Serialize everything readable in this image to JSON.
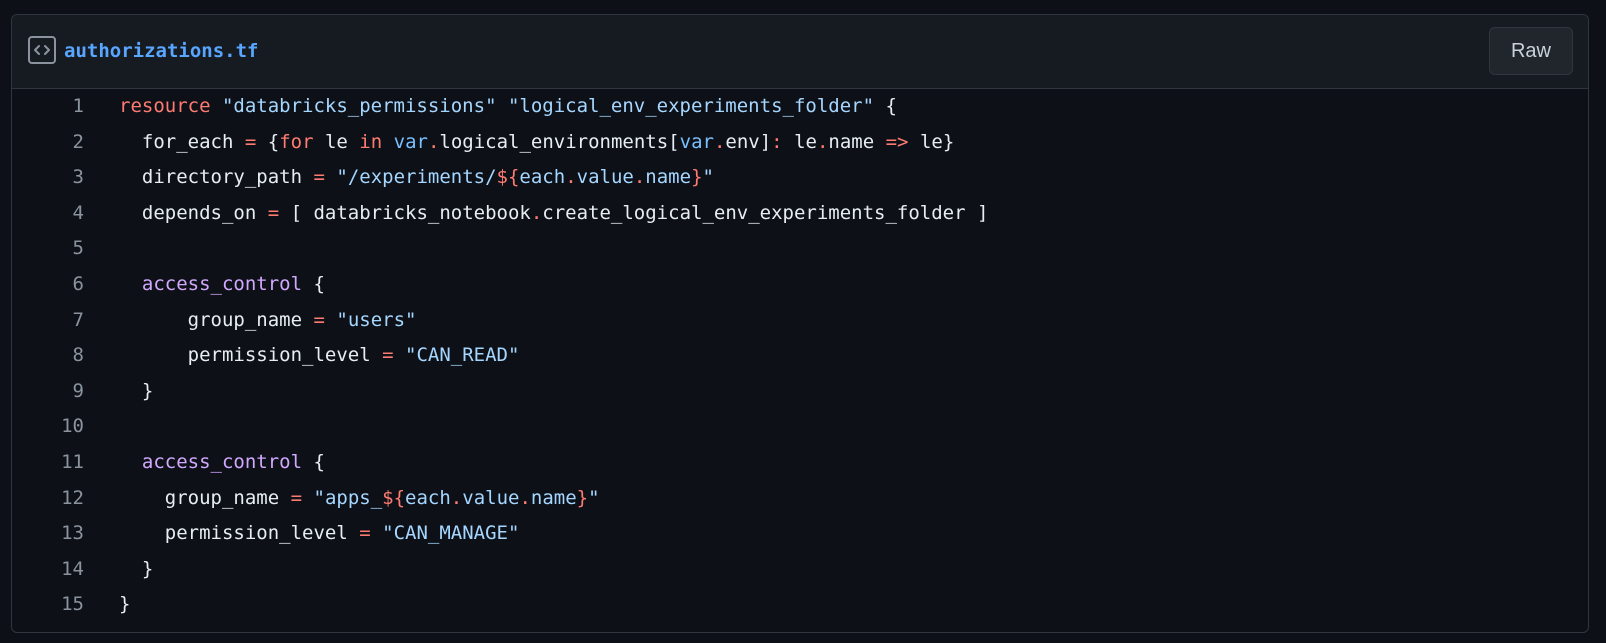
{
  "file": {
    "name": "authorizations.tf",
    "raw_label": "Raw"
  },
  "colors": {
    "background": "#0d1117",
    "header": "#161b22",
    "border": "#30363d",
    "filename": "#58a6ff",
    "keyword": "#ff7b72",
    "string": "#a5d6ff",
    "block": "#d2a8ff",
    "variable": "#79c0ff",
    "text": "#e6edf3",
    "line_number": "#8b949e"
  },
  "icons": {
    "header": "code-file-icon"
  },
  "code": {
    "lines": [
      {
        "number": "1",
        "tokens": [
          {
            "t": "resource",
            "c": "kw"
          },
          {
            "t": " ",
            "c": "plain"
          },
          {
            "t": "\"databricks_permissions\"",
            "c": "str"
          },
          {
            "t": " ",
            "c": "plain"
          },
          {
            "t": "\"logical_env_experiments_folder\"",
            "c": "str"
          },
          {
            "t": " {",
            "c": "plain"
          }
        ]
      },
      {
        "number": "2",
        "tokens": [
          {
            "t": "  for_each ",
            "c": "plain"
          },
          {
            "t": "=",
            "c": "kw"
          },
          {
            "t": " {",
            "c": "plain"
          },
          {
            "t": "for",
            "c": "kw"
          },
          {
            "t": " le ",
            "c": "plain"
          },
          {
            "t": "in",
            "c": "kw"
          },
          {
            "t": " ",
            "c": "plain"
          },
          {
            "t": "var",
            "c": "var"
          },
          {
            "t": ".",
            "c": "kw"
          },
          {
            "t": "logical_environments[",
            "c": "plain"
          },
          {
            "t": "var",
            "c": "var"
          },
          {
            "t": ".",
            "c": "kw"
          },
          {
            "t": "env]",
            "c": "plain"
          },
          {
            "t": ":",
            "c": "kw"
          },
          {
            "t": " le",
            "c": "plain"
          },
          {
            "t": ".",
            "c": "kw"
          },
          {
            "t": "name ",
            "c": "plain"
          },
          {
            "t": "=>",
            "c": "kw"
          },
          {
            "t": " le}",
            "c": "plain"
          }
        ]
      },
      {
        "number": "3",
        "tokens": [
          {
            "t": "  directory_path ",
            "c": "plain"
          },
          {
            "t": "=",
            "c": "kw"
          },
          {
            "t": " ",
            "c": "plain"
          },
          {
            "t": "\"/experiments/",
            "c": "str"
          },
          {
            "t": "${",
            "c": "kw"
          },
          {
            "t": "each",
            "c": "str"
          },
          {
            "t": ".",
            "c": "kw"
          },
          {
            "t": "value",
            "c": "str"
          },
          {
            "t": ".",
            "c": "kw"
          },
          {
            "t": "name",
            "c": "str"
          },
          {
            "t": "}",
            "c": "kw"
          },
          {
            "t": "\"",
            "c": "str"
          }
        ]
      },
      {
        "number": "4",
        "tokens": [
          {
            "t": "  depends_on ",
            "c": "plain"
          },
          {
            "t": "=",
            "c": "kw"
          },
          {
            "t": " [ databricks_notebook",
            "c": "plain"
          },
          {
            "t": ".",
            "c": "kw"
          },
          {
            "t": "create_logical_env_experiments_folder ]",
            "c": "plain"
          }
        ]
      },
      {
        "number": "5",
        "tokens": []
      },
      {
        "number": "6",
        "tokens": [
          {
            "t": "  ",
            "c": "plain"
          },
          {
            "t": "access_control",
            "c": "fn"
          },
          {
            "t": " {",
            "c": "plain"
          }
        ]
      },
      {
        "number": "7",
        "tokens": [
          {
            "t": "      group_name ",
            "c": "plain"
          },
          {
            "t": "=",
            "c": "kw"
          },
          {
            "t": " ",
            "c": "plain"
          },
          {
            "t": "\"users\"",
            "c": "str"
          }
        ]
      },
      {
        "number": "8",
        "tokens": [
          {
            "t": "      permission_level ",
            "c": "plain"
          },
          {
            "t": "=",
            "c": "kw"
          },
          {
            "t": " ",
            "c": "plain"
          },
          {
            "t": "\"CAN_READ\"",
            "c": "str"
          }
        ]
      },
      {
        "number": "9",
        "tokens": [
          {
            "t": "  }",
            "c": "plain"
          }
        ]
      },
      {
        "number": "10",
        "tokens": []
      },
      {
        "number": "11",
        "tokens": [
          {
            "t": "  ",
            "c": "plain"
          },
          {
            "t": "access_control",
            "c": "fn"
          },
          {
            "t": " {",
            "c": "plain"
          }
        ]
      },
      {
        "number": "12",
        "tokens": [
          {
            "t": "    group_name ",
            "c": "plain"
          },
          {
            "t": "=",
            "c": "kw"
          },
          {
            "t": " ",
            "c": "plain"
          },
          {
            "t": "\"apps_",
            "c": "str"
          },
          {
            "t": "${",
            "c": "kw"
          },
          {
            "t": "each",
            "c": "str"
          },
          {
            "t": ".",
            "c": "kw"
          },
          {
            "t": "value",
            "c": "str"
          },
          {
            "t": ".",
            "c": "kw"
          },
          {
            "t": "name",
            "c": "str"
          },
          {
            "t": "}",
            "c": "kw"
          },
          {
            "t": "\"",
            "c": "str"
          }
        ]
      },
      {
        "number": "13",
        "tokens": [
          {
            "t": "    permission_level ",
            "c": "plain"
          },
          {
            "t": "=",
            "c": "kw"
          },
          {
            "t": " ",
            "c": "plain"
          },
          {
            "t": "\"CAN_MANAGE\"",
            "c": "str"
          }
        ]
      },
      {
        "number": "14",
        "tokens": [
          {
            "t": "  }",
            "c": "plain"
          }
        ]
      },
      {
        "number": "15",
        "tokens": [
          {
            "t": "}",
            "c": "plain"
          }
        ]
      }
    ]
  }
}
